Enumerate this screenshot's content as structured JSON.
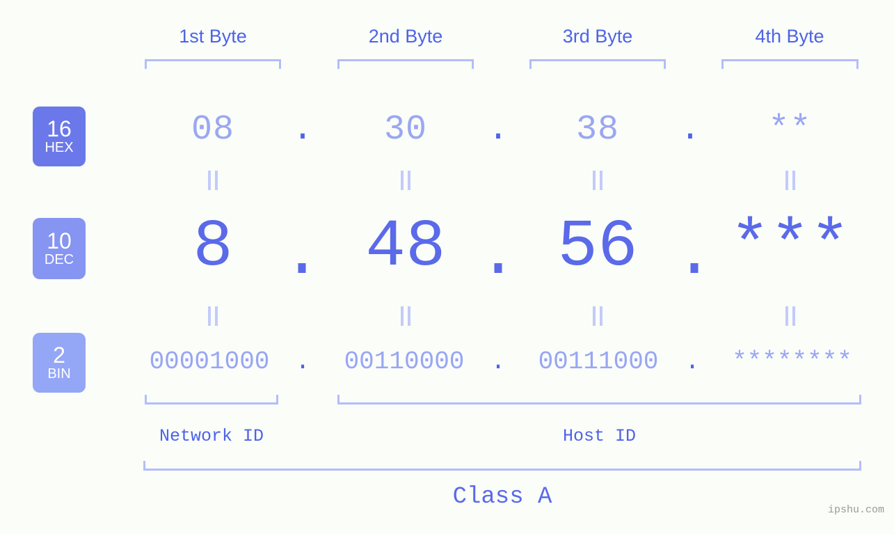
{
  "page": {
    "background": "#fbfdf9",
    "accent": "#5a6ae9",
    "bracket_color": "#b3bdfb",
    "watermark": "ipshu.com"
  },
  "byte_headers": [
    {
      "label": "1st Byte"
    },
    {
      "label": "2nd Byte"
    },
    {
      "label": "3rd Byte"
    },
    {
      "label": "4th Byte"
    }
  ],
  "radix_rows": [
    {
      "badge_number": "16",
      "badge_name": "HEX",
      "badge_color": "#6b78ea",
      "values": [
        "08",
        "30",
        "38",
        "**"
      ],
      "separator": "."
    },
    {
      "badge_number": "10",
      "badge_name": "DEC",
      "badge_color": "#8694f2",
      "values": [
        "8",
        "48",
        "56",
        "***"
      ],
      "separator": "."
    },
    {
      "badge_number": "2",
      "badge_name": "BIN",
      "badge_color": "#94a6f6",
      "values": [
        "00001000",
        "00110000",
        "00111000",
        "********"
      ],
      "separator": "."
    }
  ],
  "equals_separator": "=",
  "id_sections": [
    {
      "label": "Network ID"
    },
    {
      "label": "Host ID"
    }
  ],
  "class_section": {
    "label": "Class A"
  }
}
